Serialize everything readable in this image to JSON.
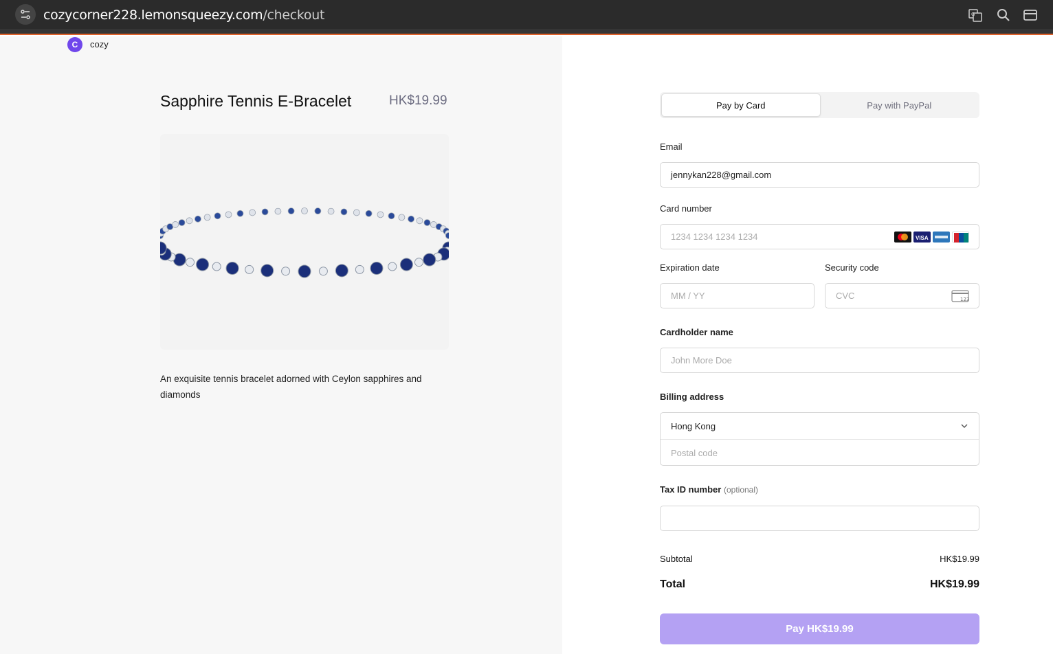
{
  "browser": {
    "url_host": "cozycorner228.lemonsqueezy.com",
    "url_path": "/checkout",
    "icons": [
      "site-settings-icon",
      "translate-icon",
      "zoom-icon",
      "card-icon"
    ]
  },
  "store": {
    "logo_letter": "C",
    "name": "cozy",
    "brand_color": "#7047eb"
  },
  "product": {
    "title": "Sapphire Tennis E-Bracelet",
    "price": "HK$19.99",
    "description": "An exquisite tennis bracelet adorned with Ceylon sapphires and diamonds"
  },
  "payment": {
    "tabs": [
      {
        "label": "Pay by Card",
        "active": true
      },
      {
        "label": "Pay with PayPal",
        "active": false
      }
    ],
    "email": {
      "label": "Email",
      "value": "jennykan228@gmail.com"
    },
    "card_number": {
      "label": "Card number",
      "placeholder": "1234 1234 1234 1234",
      "brands": [
        "mastercard",
        "visa",
        "amex",
        "unionpay"
      ]
    },
    "expiration": {
      "label": "Expiration date",
      "placeholder": "MM / YY"
    },
    "security": {
      "label": "Security code",
      "placeholder": "CVC"
    },
    "cardholder": {
      "label": "Cardholder name",
      "placeholder": "John More Doe"
    },
    "billing": {
      "label": "Billing address",
      "country": "Hong Kong",
      "postal_placeholder": "Postal code"
    },
    "tax_id": {
      "label": "Tax ID number",
      "optional": "(optional)",
      "value": ""
    }
  },
  "summary": {
    "subtotal_label": "Subtotal",
    "subtotal_value": "HK$19.99",
    "total_label": "Total",
    "total_value": "HK$19.99"
  },
  "pay_button": {
    "label": "Pay HK$19.99",
    "color": "#b4a1f3"
  }
}
